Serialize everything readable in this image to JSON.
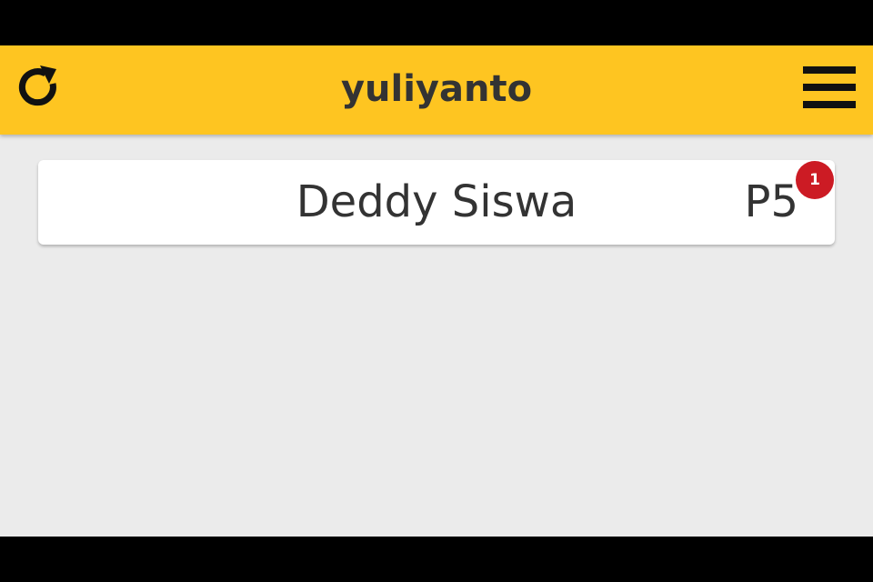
{
  "header": {
    "title": "yuliyanto",
    "refresh_icon": "refresh-icon",
    "menu_icon": "hamburger-menu-icon",
    "background_color": "#fec521"
  },
  "chat_list": [
    {
      "name": "Deddy Siswa",
      "code": "P5",
      "unread_count": "1",
      "badge_color": "#cc1b24"
    }
  ],
  "colors": {
    "screen_background": "#ebebeb",
    "text": "#333333"
  }
}
